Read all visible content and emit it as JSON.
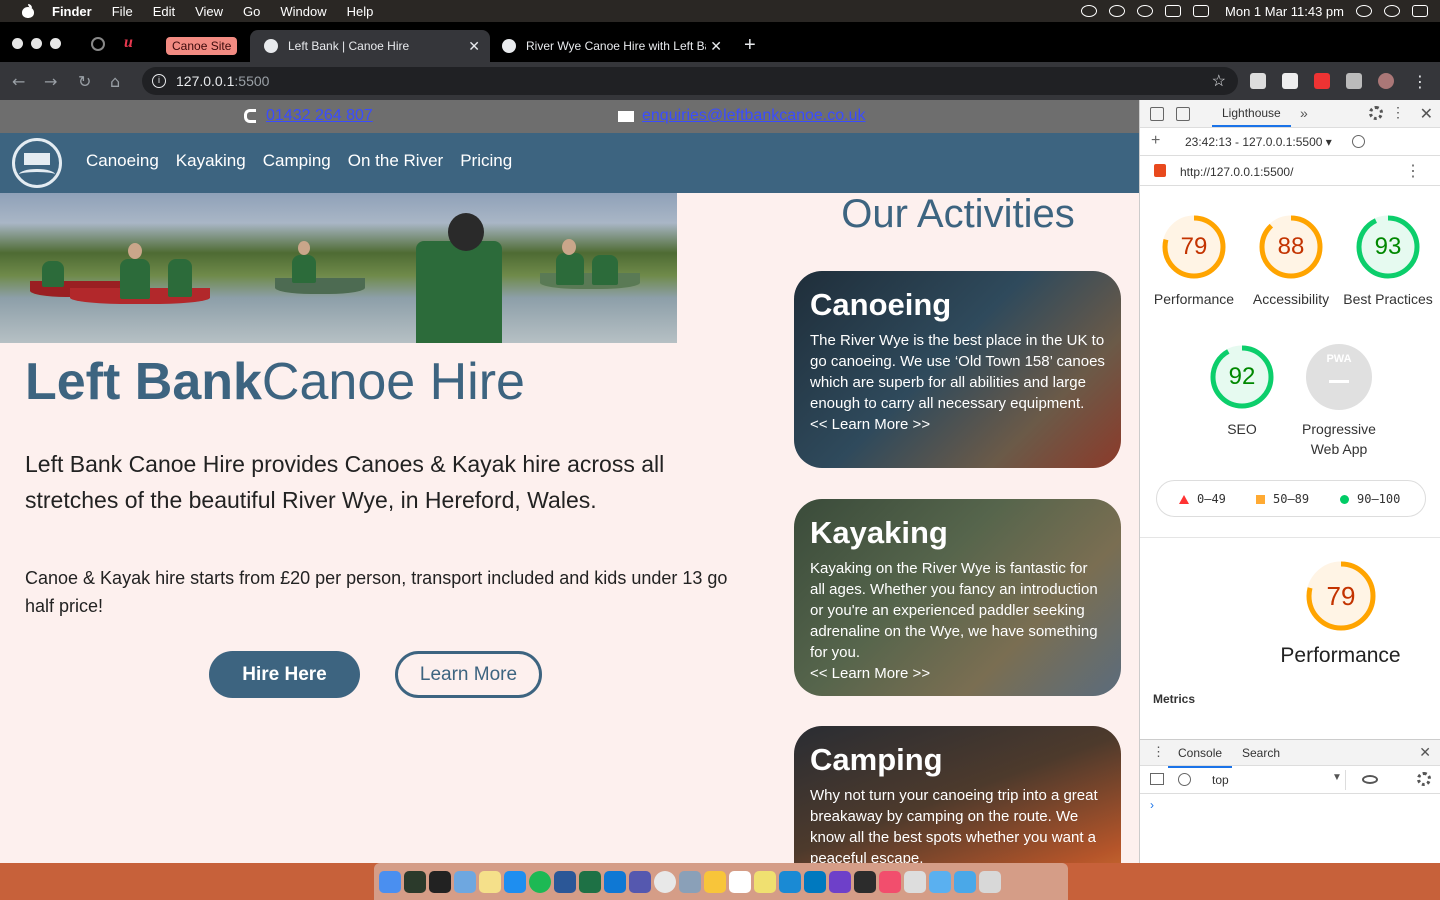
{
  "menubar": {
    "app": "Finder",
    "items": [
      "File",
      "Edit",
      "View",
      "Go",
      "Window",
      "Help"
    ],
    "clock": "Mon 1 Mar  11:43 pm"
  },
  "browser": {
    "tab_group_label": "Canoe Site",
    "tabs": [
      {
        "title": "Left Bank | Canoe Hire",
        "active": true
      },
      {
        "title": "River Wye Canoe Hire with Left Bank",
        "active": false
      }
    ],
    "url_host": "127.0.0.1",
    "url_port": ":5500"
  },
  "site": {
    "phone": "01432 264 807",
    "email": "enquiries@leftbankcanoe.co.uk",
    "nav": [
      "Canoeing",
      "Kayaking",
      "Camping",
      "On the River",
      "Pricing"
    ],
    "heading_bold": "Left Bank",
    "heading_light": "Canoe Hire",
    "lead": "Left Bank Canoe Hire provides Canoes & Kayak hire across all stretches of the beautiful River Wye, in Hereford, Wales.",
    "price_note": "Canoe & Kayak hire starts from £20 per person, transport included and kids under 13 go half price!",
    "hire_button": "Hire Here",
    "learn_button": "Learn More",
    "activities_title": "Our Activities",
    "cards": [
      {
        "title": "Canoeing",
        "body": "The River Wye is the best place in the UK to go canoeing. We use ‘Old Town 158’ canoes which are superb for all abilities and large enough to carry all necessary equipment.",
        "link": "<< Learn More >>"
      },
      {
        "title": "Kayaking",
        "body": "Kayaking on the River Wye is fantastic for all ages. Whether you fancy an introduction or you're an experienced paddler seeking adrenaline on the Wye, we have something for you.",
        "link": "<< Learn More >>"
      },
      {
        "title": "Camping",
        "body": "Why not turn your canoeing trip into a great breakaway by camping on the route. We know all the best spots whether you want a peaceful escape,",
        "link": ""
      }
    ]
  },
  "devtools": {
    "panel_tab": "Lighthouse",
    "report_label": "23:42:13 - 127.0.0.1:5500",
    "report_url": "http://127.0.0.1:5500/",
    "scores": [
      {
        "label": "Performance",
        "value": 79,
        "color": "#ffa400"
      },
      {
        "label": "Accessibility",
        "value": 88,
        "color": "#ffa400"
      },
      {
        "label": "Best Practices",
        "value": 93,
        "color": "#0cce6b"
      },
      {
        "label": "SEO",
        "value": 92,
        "color": "#0cce6b"
      },
      {
        "label": "Progressive Web App",
        "value": null,
        "color": "#cccccc"
      }
    ],
    "pwa_badge": "PWA",
    "legend": [
      "0–49",
      "50–89",
      "90–100"
    ],
    "focus_score": 79,
    "focus_label": "Performance",
    "metrics_label": "Metrics",
    "drawer_tabs": [
      "Console",
      "Search"
    ],
    "context": "top",
    "prompt": "›"
  }
}
